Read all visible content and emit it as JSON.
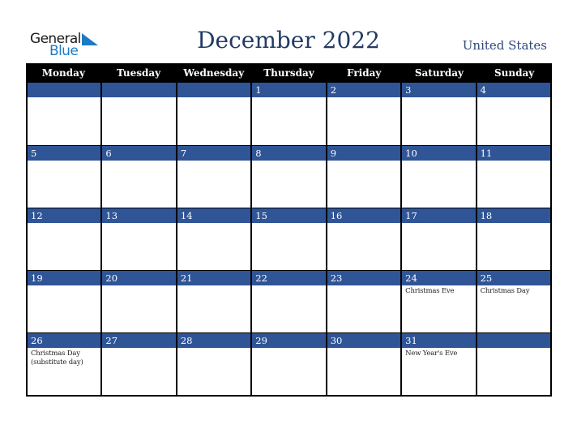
{
  "logo": {
    "line1": "General",
    "line2": "Blue"
  },
  "header": {
    "title": "December 2022",
    "country": "United States"
  },
  "colors": {
    "title": "#243a63",
    "day_bar": "#2f5597",
    "header_bg": "#000000",
    "logo_blue": "#1a7ac4"
  },
  "weekdays": [
    "Monday",
    "Tuesday",
    "Wednesday",
    "Thursday",
    "Friday",
    "Saturday",
    "Sunday"
  ],
  "weeks": [
    [
      {
        "day": "",
        "holiday": ""
      },
      {
        "day": "",
        "holiday": ""
      },
      {
        "day": "",
        "holiday": ""
      },
      {
        "day": "1",
        "holiday": ""
      },
      {
        "day": "2",
        "holiday": ""
      },
      {
        "day": "3",
        "holiday": ""
      },
      {
        "day": "4",
        "holiday": ""
      }
    ],
    [
      {
        "day": "5",
        "holiday": ""
      },
      {
        "day": "6",
        "holiday": ""
      },
      {
        "day": "7",
        "holiday": ""
      },
      {
        "day": "8",
        "holiday": ""
      },
      {
        "day": "9",
        "holiday": ""
      },
      {
        "day": "10",
        "holiday": ""
      },
      {
        "day": "11",
        "holiday": ""
      }
    ],
    [
      {
        "day": "12",
        "holiday": ""
      },
      {
        "day": "13",
        "holiday": ""
      },
      {
        "day": "14",
        "holiday": ""
      },
      {
        "day": "15",
        "holiday": ""
      },
      {
        "day": "16",
        "holiday": ""
      },
      {
        "day": "17",
        "holiday": ""
      },
      {
        "day": "18",
        "holiday": ""
      }
    ],
    [
      {
        "day": "19",
        "holiday": ""
      },
      {
        "day": "20",
        "holiday": ""
      },
      {
        "day": "21",
        "holiday": ""
      },
      {
        "day": "22",
        "holiday": ""
      },
      {
        "day": "23",
        "holiday": ""
      },
      {
        "day": "24",
        "holiday": "Christmas Eve"
      },
      {
        "day": "25",
        "holiday": "Christmas Day"
      }
    ],
    [
      {
        "day": "26",
        "holiday": "Christmas Day (substitute day)"
      },
      {
        "day": "27",
        "holiday": ""
      },
      {
        "day": "28",
        "holiday": ""
      },
      {
        "day": "29",
        "holiday": ""
      },
      {
        "day": "30",
        "holiday": ""
      },
      {
        "day": "31",
        "holiday": "New Year's Eve"
      },
      {
        "day": "",
        "holiday": ""
      }
    ]
  ]
}
